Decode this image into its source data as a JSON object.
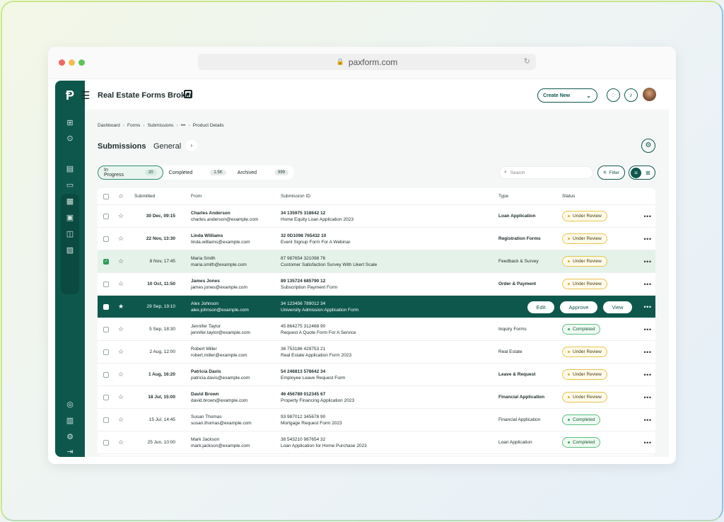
{
  "browser": {
    "url": "paxform.com"
  },
  "header": {
    "title": "Real Estate Forms Broker",
    "create_label": "Create New"
  },
  "breadcrumb": [
    "Dashboard",
    "Forms",
    "Submissions",
    "•••",
    "Product Details"
  ],
  "page": {
    "title": "Submissions",
    "subtitle": "General"
  },
  "tabs": [
    {
      "label": "In Progress",
      "count": "20"
    },
    {
      "label": "Completed",
      "count": "1.5K"
    },
    {
      "label": "Archived",
      "count": "999"
    }
  ],
  "search": {
    "placeholder": "Search"
  },
  "filter_label": "Filter",
  "columns": {
    "submitted": "Submitted",
    "from": "From",
    "id": "Submission ID",
    "type": "Type",
    "status": "Status"
  },
  "row_actions": {
    "edit": "Edit",
    "approve": "Approve",
    "view": "View"
  },
  "rows": [
    {
      "date": "30 Dec, 09:15",
      "name": "Charles Anderson",
      "email": "charles.anderson@example.com",
      "sid": "34 135975 318642 12",
      "form": "Home Equity Loan Application 2023",
      "type": "Loan Application",
      "status": "Under Review"
    },
    {
      "date": "22 Nov, 13:30",
      "name": "Linda Williams",
      "email": "linda.williams@example.com",
      "sid": "32 0D1098 765432 10",
      "form": "Event Signup Form For A Webinar",
      "type": "Registration Forms",
      "status": "Under Review"
    },
    {
      "date": "8 Nov, 17:45",
      "name": "Maria Smith",
      "email": "maria.smith@example.com",
      "sid": "87 987654 321098 76",
      "form": "Customer Satisfaction Survey With Likert Scale",
      "type": "Feedback & Survey",
      "status": "Under Review"
    },
    {
      "date": "10 Oct, 11:50",
      "name": "James Jones",
      "email": "james.jones@example.com",
      "sid": "89 135724 685790 12",
      "form": "Subscription Payment Form",
      "type": "Order & Payment",
      "status": "Under Review"
    },
    {
      "date": "29 Sep, 19:10",
      "name": "Alex Johnson",
      "email": "alex.johnson@example.com",
      "sid": "34 123456 789012 34",
      "form": "University Admission Application Form",
      "type": "",
      "status": ""
    },
    {
      "date": "5 Sep, 18:30",
      "name": "Jennifer Taylor",
      "email": "jennifer.taylor@example.com",
      "sid": "45 864275 312468 90",
      "form": "Request A Quote Form For A Service",
      "type": "Inquiry Forms",
      "status": "Completed"
    },
    {
      "date": "2 Aug, 12:00",
      "name": "Robert Miller",
      "email": "robert.miller@example.com",
      "sid": "36 753186 429753 21",
      "form": "Real Estate Application Form 2023",
      "type": "Real Estate",
      "status": "Under Review"
    },
    {
      "date": "1 Aug, 16:20",
      "name": "Patricia Davis",
      "email": "patricia.davis@example.com",
      "sid": "54 246813 578642 34",
      "form": "Employee Leave Request Form",
      "type": "Leave & Request",
      "status": "Under Review"
    },
    {
      "date": "18 Jul, 15:00",
      "name": "David Brown",
      "email": "david.brown@example.com",
      "sid": "46 456789 012345 67",
      "form": "Property Financing Application 2023",
      "type": "Financial Application",
      "status": "Under Review"
    },
    {
      "date": "15 Jul, 14:45",
      "name": "Susan Thomas",
      "email": "susan.thomas@example.com",
      "sid": "93 987012 345678 90",
      "form": "Mortgage Request Form 2023",
      "type": "Financial Application",
      "status": "Completed"
    },
    {
      "date": "25 Jun, 10:00",
      "name": "Mark Jackson",
      "email": "mark.jackson@example.com",
      "sid": "38 543210 987654 32",
      "form": "Loan Application for Home Purchase 2023",
      "type": "Loan Application",
      "status": "Completed"
    }
  ],
  "row_styles": [
    {
      "weight": "bold",
      "state": "normal"
    },
    {
      "weight": "bold",
      "state": "normal"
    },
    {
      "weight": "normal",
      "state": "checked"
    },
    {
      "weight": "bold",
      "state": "normal"
    },
    {
      "weight": "normal",
      "state": "highlight"
    },
    {
      "weight": "normal",
      "state": "normal"
    },
    {
      "weight": "normal",
      "state": "normal"
    },
    {
      "weight": "bold",
      "state": "normal"
    },
    {
      "weight": "bold",
      "state": "normal"
    },
    {
      "weight": "normal",
      "state": "normal"
    },
    {
      "weight": "normal",
      "state": "normal"
    }
  ],
  "colors": {
    "brand": "#0e574d",
    "review": "#e8c34f",
    "completed": "#5fbf80"
  }
}
